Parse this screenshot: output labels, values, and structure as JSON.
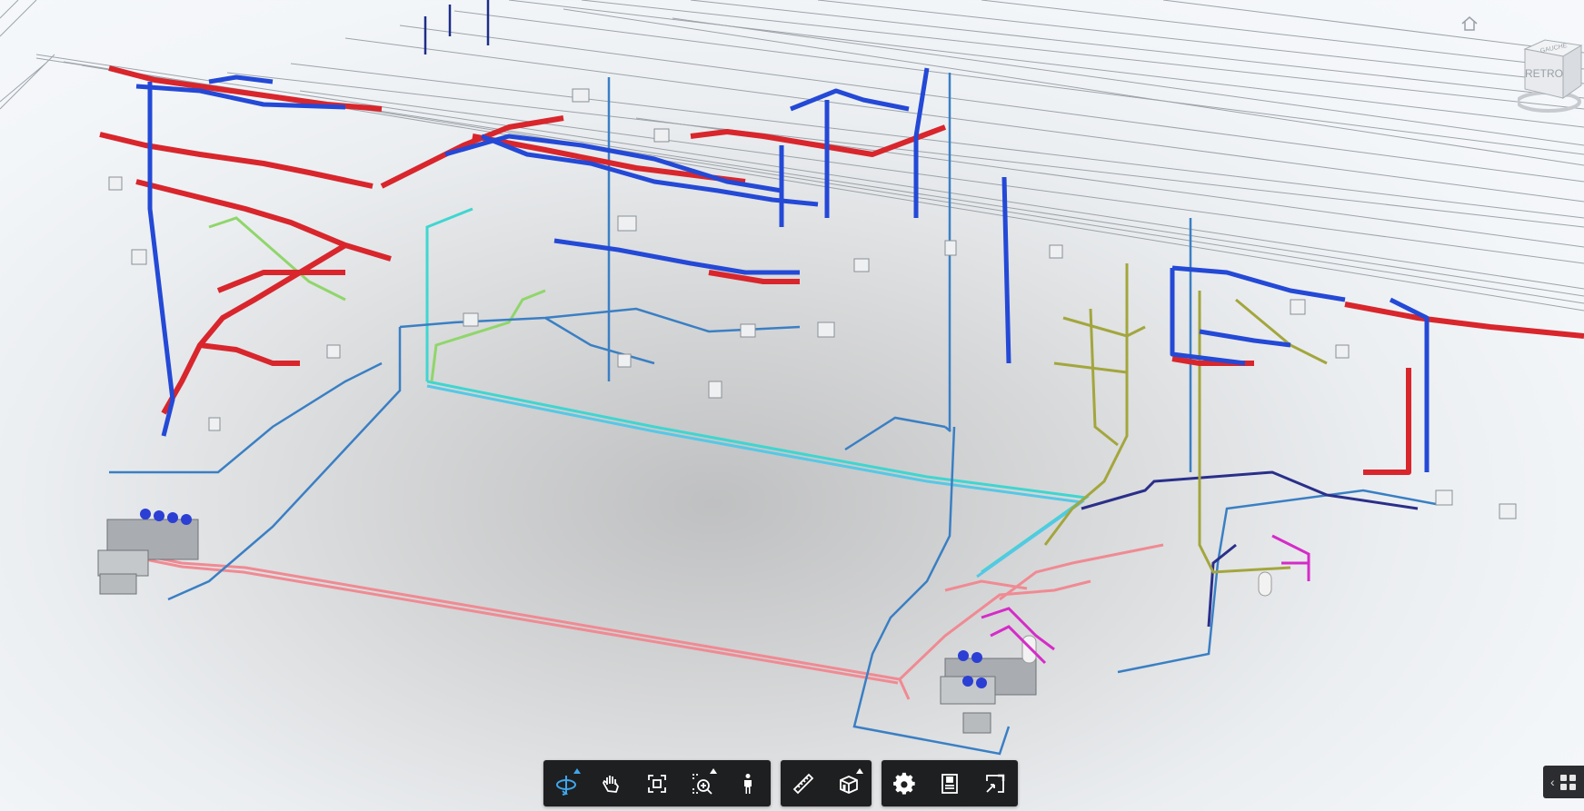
{
  "viewcube": {
    "face_label": "RETRO",
    "top_label": "GAUCHE"
  },
  "toolbar": {
    "navigation": [
      {
        "name": "orbit-tool",
        "icon": "orbit-icon",
        "flyout": true,
        "active": true
      },
      {
        "name": "pan-tool",
        "icon": "hand-icon",
        "flyout": false,
        "active": false
      },
      {
        "name": "fit-to-view-tool",
        "icon": "fit-view-icon",
        "flyout": false,
        "active": false
      },
      {
        "name": "camera-interactions-tool",
        "icon": "camera-zoom-icon",
        "flyout": true,
        "active": false
      },
      {
        "name": "first-person-tool",
        "icon": "person-icon",
        "flyout": false,
        "active": false
      }
    ],
    "modeling": [
      {
        "name": "measure-tool",
        "icon": "ruler-icon",
        "flyout": false,
        "active": false
      },
      {
        "name": "section-analysis-tool",
        "icon": "section-box-icon",
        "flyout": true,
        "active": false
      }
    ],
    "settings": [
      {
        "name": "settings-tool",
        "icon": "gear-icon",
        "flyout": false,
        "active": false
      },
      {
        "name": "properties-tool",
        "icon": "properties-icon",
        "flyout": false,
        "active": false
      },
      {
        "name": "fullscreen-tool",
        "icon": "fullscreen-icon",
        "flyout": false,
        "active": false
      }
    ]
  },
  "panel_toggle": {
    "icon": "chevron-left-icon"
  },
  "colors": {
    "supply_duct": "#d8262c",
    "return_duct": "#2449d6",
    "pipe_blue": "#3a7fc4",
    "pipe_cyan": "#3fd6d0",
    "pipe_green": "#8fd66a",
    "pipe_olive": "#a3a63c",
    "pipe_pink": "#f08a93",
    "pipe_magenta": "#d52bc8",
    "toolbar_bg": "#1e1f21",
    "accent": "#3fa6ea"
  }
}
